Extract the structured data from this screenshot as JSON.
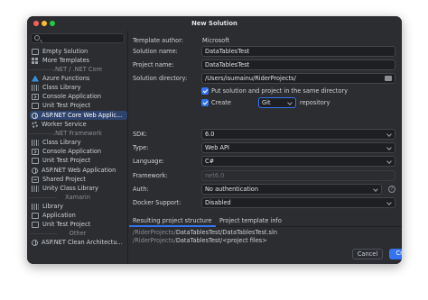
{
  "window": {
    "title": "New Solution"
  },
  "sidebar": {
    "search_placeholder": "",
    "items": [
      {
        "label": "Empty Solution",
        "icon": "solution-icon"
      },
      {
        "label": "More Templates",
        "icon": "templates-grid-icon"
      },
      {
        "group": ".NET / .NET Core"
      },
      {
        "label": "Azure Functions",
        "icon": "azure-icon"
      },
      {
        "label": "Class Library",
        "icon": "library-icon"
      },
      {
        "label": "Console Application",
        "icon": "console-icon"
      },
      {
        "label": "Unit Test Project",
        "icon": "test-icon"
      },
      {
        "label": "ASP.NET Core Web Applic...",
        "icon": "web-icon",
        "selected": true
      },
      {
        "label": "Worker Service",
        "icon": "gear-icon"
      },
      {
        "group": ".NET Framework"
      },
      {
        "label": "Class Library",
        "icon": "library-icon"
      },
      {
        "label": "Console Application",
        "icon": "console-icon"
      },
      {
        "label": "Unit Test Project",
        "icon": "test-icon"
      },
      {
        "label": "ASP.NET Web Application",
        "icon": "web-icon"
      },
      {
        "label": "Shared Project",
        "icon": "shared-icon"
      },
      {
        "label": "Unity Class Library",
        "icon": "library-icon"
      },
      {
        "group": "Xamarin"
      },
      {
        "label": "Library",
        "icon": "library-icon"
      },
      {
        "label": "Application",
        "icon": "app-icon"
      },
      {
        "label": "Unit Test Project",
        "icon": "test-icon"
      },
      {
        "group": "Other"
      },
      {
        "label": "ASP.NET Clean Architectu...",
        "icon": "web-icon"
      }
    ]
  },
  "form": {
    "template_author_label": "Template author:",
    "template_author_value": "Microsoft",
    "solution_name_label": "Solution name:",
    "solution_name_value": "DataTablesTest",
    "project_name_label": "Project name:",
    "project_name_value": "DataTablesTest",
    "solution_directory_label": "Solution directory:",
    "solution_directory_value": "/Users/isumainu/RiderProjects/",
    "same_dir_label": "Put solution and project in the same directory",
    "create_label": "Create",
    "vcs_value": "Git",
    "repository_label": "repository",
    "sdk_label": "SDK:",
    "sdk_value": "6.0",
    "type_label": "Type:",
    "type_value": "Web API",
    "language_label": "Language:",
    "language_value": "C#",
    "framework_label": "Framework:",
    "framework_value": "net6.0",
    "auth_label": "Auth:",
    "auth_value": "No authentication",
    "auth_help": "?",
    "docker_label": "Docker Support:",
    "docker_value": "Disabled"
  },
  "tabs": [
    {
      "label": "Resulting project structure",
      "active": true
    },
    {
      "label": "Project template info",
      "active": false
    }
  ],
  "preview": {
    "line1_prefix": "/RiderProjects/",
    "line1_highlight": "DataTablesTest/DataTablesTest.sln",
    "line2_prefix": "/RiderProjects/",
    "line2_highlight": "DataTablesTest/<project files>"
  },
  "buttons": {
    "cancel": "Cancel",
    "create": "Create"
  },
  "colors": {
    "accent": "#3574f0",
    "background": "#2b2d30",
    "selection": "#2e436e"
  }
}
